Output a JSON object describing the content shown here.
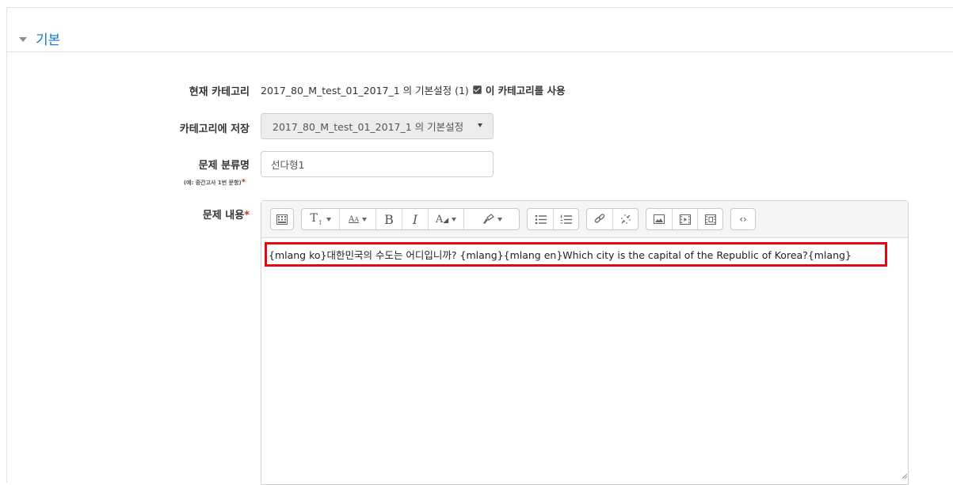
{
  "section": {
    "title": "기본",
    "collapse_icon": "triangle-down-icon"
  },
  "current_category": {
    "label": "현재 카테고리",
    "value": "2017_80_M_test_01_2017_1 의 기본설정 (1)",
    "checkbox_checked": true,
    "checkbox_label": "이 카테고리를 사용"
  },
  "save_category": {
    "label": "카테고리에 저장",
    "selected": "2017_80_M_test_01_2017_1 의 기본설정"
  },
  "question_name": {
    "label": "문제 분류명",
    "hint": "(예: 중간고사 1번 문항)",
    "required_mark": "*",
    "value": "선다형1"
  },
  "question_text": {
    "label": "문제 내용",
    "required_mark": "*",
    "content": "{mlang ko}대한민국의 수도는 어디입니까? {mlang}{mlang en}Which city is the capital of the Republic of Korea?{mlang}"
  },
  "toolbar": {
    "buttons": [
      "toggle-toolbar",
      "paragraph-style",
      "font-size",
      "bold",
      "italic",
      "font-color",
      "background-color",
      "unordered-list",
      "ordered-list",
      "link",
      "unlink",
      "image",
      "media",
      "manage-media",
      "html"
    ]
  },
  "colors": {
    "accent": "#1177d1",
    "highlight_border": "#e30613",
    "required": "#c9302c"
  }
}
